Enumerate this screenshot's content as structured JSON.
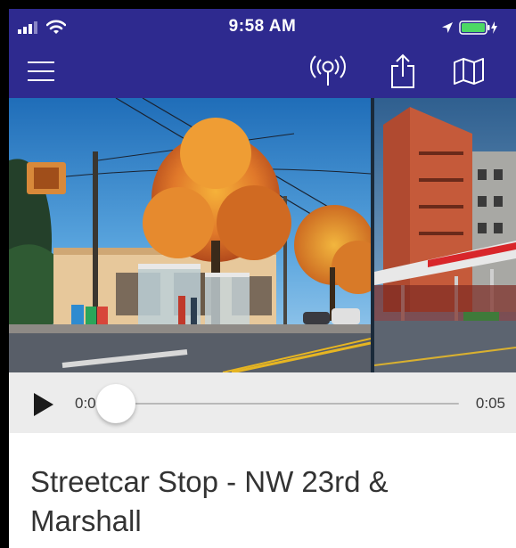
{
  "status_bar": {
    "time": "9:58 AM",
    "icons": [
      "cellular-signal-icon",
      "wifi-icon",
      "location-arrow-icon",
      "battery-charging-icon"
    ],
    "battery_color": "#4cd964"
  },
  "nav": {
    "background": "#2e2a8f",
    "buttons": [
      "menu-icon",
      "radio-broadcast-icon",
      "share-icon",
      "map-icon"
    ]
  },
  "photos": [
    {
      "subject": "streetcar stop with autumn tree"
    },
    {
      "subject": "brick hospital building with emergency entrance"
    }
  ],
  "player": {
    "current_time": "0:00",
    "total_time": "0:05",
    "progress": 0.0
  },
  "stop": {
    "title": "Streetcar Stop - NW 23rd & Marshall"
  }
}
